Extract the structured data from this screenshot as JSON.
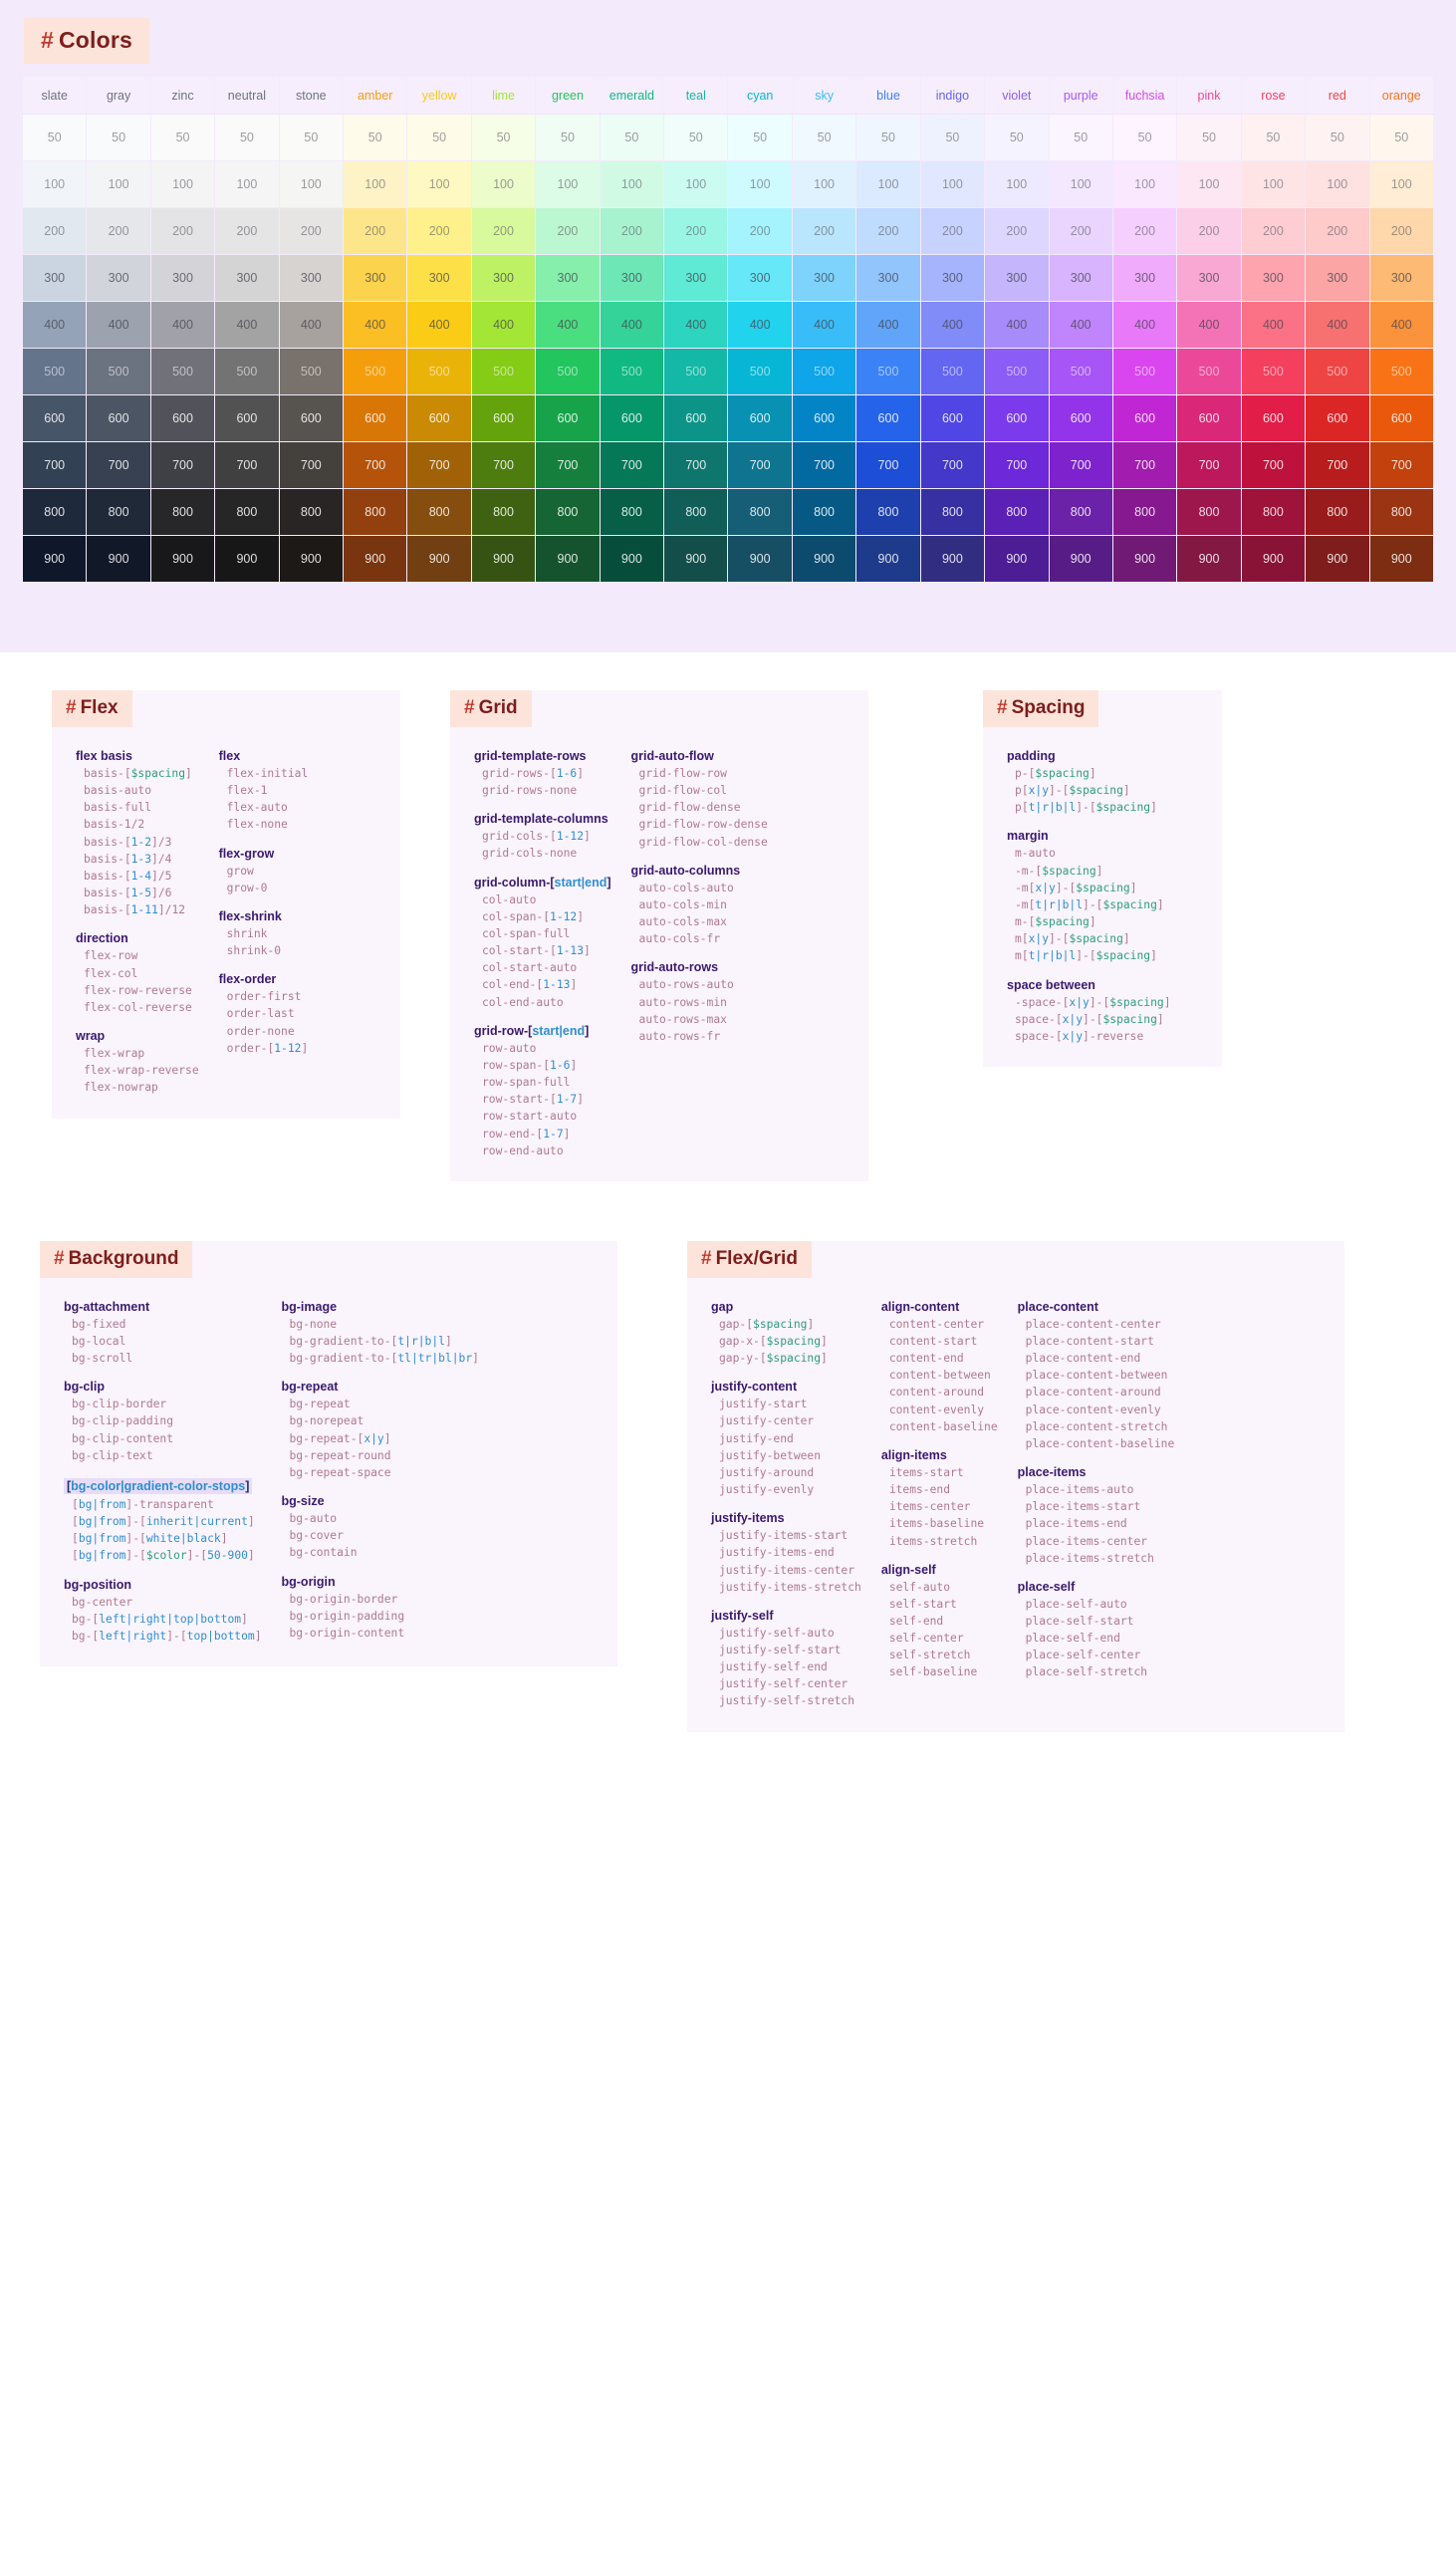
{
  "colors": {
    "heading": "Colors",
    "hash": "#",
    "columns": [
      "slate",
      "gray",
      "zinc",
      "neutral",
      "stone",
      "amber",
      "yellow",
      "lime",
      "green",
      "emerald",
      "teal",
      "cyan",
      "sky",
      "blue",
      "indigo",
      "violet",
      "purple",
      "fuchsia",
      "pink",
      "rose",
      "red",
      "orange"
    ],
    "header_text_colors": [
      "#6b7280",
      "#6b7280",
      "#6b7280",
      "#6b7280",
      "#6b7280",
      "#f59e0b",
      "#facc15",
      "#a3e635",
      "#22c55e",
      "#10b981",
      "#14b8a6",
      "#06b6d4",
      "#38bdf8",
      "#3b82f6",
      "#6366f1",
      "#8b5cf6",
      "#a855f7",
      "#d946ef",
      "#ec4899",
      "#f43f5e",
      "#ef4444",
      "#f97316"
    ],
    "shades": [
      "50",
      "100",
      "200",
      "300",
      "400",
      "500",
      "600",
      "700",
      "800",
      "900"
    ],
    "palette": {
      "slate": [
        "#f8fafc",
        "#f1f5f9",
        "#e2e8f0",
        "#cbd5e1",
        "#94a3b8",
        "#64748b",
        "#475569",
        "#334155",
        "#1e293b",
        "#0f172a"
      ],
      "gray": [
        "#f9fafb",
        "#f3f4f6",
        "#e5e7eb",
        "#d1d5db",
        "#9ca3af",
        "#6b7280",
        "#4b5563",
        "#374151",
        "#1f2937",
        "#111827"
      ],
      "zinc": [
        "#fafafa",
        "#f4f4f5",
        "#e4e4e7",
        "#d4d4d8",
        "#a1a1aa",
        "#71717a",
        "#52525b",
        "#3f3f46",
        "#27272a",
        "#18181b"
      ],
      "neutral": [
        "#fafafa",
        "#f5f5f5",
        "#e5e5e5",
        "#d4d4d4",
        "#a3a3a3",
        "#737373",
        "#525252",
        "#404040",
        "#262626",
        "#171717"
      ],
      "stone": [
        "#fafaf9",
        "#f5f5f4",
        "#e7e5e4",
        "#d6d3d1",
        "#a8a29e",
        "#78716c",
        "#57534e",
        "#44403c",
        "#292524",
        "#1c1917"
      ],
      "amber": [
        "#fffbeb",
        "#fef3c7",
        "#fde68a",
        "#fcd34d",
        "#fbbf24",
        "#f59e0b",
        "#d97706",
        "#b45309",
        "#92400e",
        "#78350f"
      ],
      "yellow": [
        "#fefce8",
        "#fef9c3",
        "#fef08a",
        "#fde047",
        "#facc15",
        "#eab308",
        "#ca8a04",
        "#a16207",
        "#854d0e",
        "#713f12"
      ],
      "lime": [
        "#f7fee7",
        "#ecfccb",
        "#d9f99d",
        "#bef264",
        "#a3e635",
        "#84cc16",
        "#65a30d",
        "#4d7c0f",
        "#3f6212",
        "#365314"
      ],
      "green": [
        "#f0fdf4",
        "#dcfce7",
        "#bbf7d0",
        "#86efac",
        "#4ade80",
        "#22c55e",
        "#16a34a",
        "#15803d",
        "#166534",
        "#14532d"
      ],
      "emerald": [
        "#ecfdf5",
        "#d1fae5",
        "#a7f3d0",
        "#6ee7b7",
        "#34d399",
        "#10b981",
        "#059669",
        "#047857",
        "#065f46",
        "#064e3b"
      ],
      "teal": [
        "#f0fdfa",
        "#ccfbf1",
        "#99f6e4",
        "#5eead4",
        "#2dd4bf",
        "#14b8a6",
        "#0d9488",
        "#0f766e",
        "#115e59",
        "#134e4a"
      ],
      "cyan": [
        "#ecfeff",
        "#cffafe",
        "#a5f3fc",
        "#67e8f9",
        "#22d3ee",
        "#06b6d4",
        "#0891b2",
        "#0e7490",
        "#155e75",
        "#164e63"
      ],
      "sky": [
        "#f0f9ff",
        "#e0f2fe",
        "#bae6fd",
        "#7dd3fc",
        "#38bdf8",
        "#0ea5e9",
        "#0284c7",
        "#0369a1",
        "#075985",
        "#0c4a6e"
      ],
      "blue": [
        "#eff6ff",
        "#dbeafe",
        "#bfdbfe",
        "#93c5fd",
        "#60a5fa",
        "#3b82f6",
        "#2563eb",
        "#1d4ed8",
        "#1e40af",
        "#1e3a8a"
      ],
      "indigo": [
        "#eef2ff",
        "#e0e7ff",
        "#c7d2fe",
        "#a5b4fc",
        "#818cf8",
        "#6366f1",
        "#4f46e5",
        "#4338ca",
        "#3730a3",
        "#312e81"
      ],
      "violet": [
        "#f5f3ff",
        "#ede9fe",
        "#ddd6fe",
        "#c4b5fd",
        "#a78bfa",
        "#8b5cf6",
        "#7c3aed",
        "#6d28d9",
        "#5b21b6",
        "#4c1d95"
      ],
      "purple": [
        "#faf5ff",
        "#f3e8ff",
        "#e9d5ff",
        "#d8b4fe",
        "#c084fc",
        "#a855f7",
        "#9333ea",
        "#7e22ce",
        "#6b21a8",
        "#581c87"
      ],
      "fuchsia": [
        "#fdf4ff",
        "#fae8ff",
        "#f5d0fe",
        "#f0abfc",
        "#e879f9",
        "#d946ef",
        "#c026d3",
        "#a21caf",
        "#86198f",
        "#701a75"
      ],
      "pink": [
        "#fdf2f8",
        "#fce7f3",
        "#fbcfe8",
        "#f9a8d4",
        "#f472b6",
        "#ec4899",
        "#db2777",
        "#be185d",
        "#9d174d",
        "#831843"
      ],
      "rose": [
        "#fff1f2",
        "#ffe4e6",
        "#fecdd3",
        "#fda4af",
        "#fb7185",
        "#f43f5e",
        "#e11d48",
        "#be123c",
        "#9f1239",
        "#881337"
      ],
      "red": [
        "#fef2f2",
        "#fee2e2",
        "#fecaca",
        "#fca5a5",
        "#f87171",
        "#ef4444",
        "#dc2626",
        "#b91c1c",
        "#991b1b",
        "#7f1d1d"
      ],
      "orange": [
        "#fff7ed",
        "#ffedd5",
        "#fed7aa",
        "#fdba74",
        "#fb923c",
        "#f97316",
        "#ea580c",
        "#c2410c",
        "#9a3412",
        "#7c2d12"
      ]
    }
  },
  "cards": [
    {
      "id": "flex",
      "heading": "Flex",
      "columns": [
        {
          "groups": [
            {
              "title": "flex basis",
              "highlight": false,
              "items": [
                "basis-[$spacing]",
                "basis-auto",
                "basis-full",
                "basis-1/2",
                "basis-[1-2]/3",
                "basis-[1-3]/4",
                "basis-[1-4]/5",
                "basis-[1-5]/6",
                "basis-[1-11]/12"
              ]
            },
            {
              "title": "direction",
              "highlight": false,
              "items": [
                "flex-row",
                "flex-col",
                "flex-row-reverse",
                "flex-col-reverse"
              ]
            },
            {
              "title": "wrap",
              "highlight": false,
              "items": [
                "flex-wrap",
                "flex-wrap-reverse",
                "flex-nowrap"
              ]
            }
          ]
        },
        {
          "groups": [
            {
              "title": "flex",
              "highlight": false,
              "items": [
                "flex-initial",
                "flex-1",
                "flex-auto",
                "flex-none"
              ]
            },
            {
              "title": "flex-grow",
              "highlight": false,
              "items": [
                "grow",
                "grow-0"
              ]
            },
            {
              "title": "flex-shrink",
              "highlight": false,
              "items": [
                "shrink",
                "shrink-0"
              ]
            },
            {
              "title": "flex-order",
              "highlight": false,
              "items": [
                "order-first",
                "order-last",
                "order-none",
                "order-[1-12]"
              ]
            }
          ]
        }
      ]
    },
    {
      "id": "grid",
      "heading": "Grid",
      "columns": [
        {
          "groups": [
            {
              "title": "grid-template-rows",
              "highlight": false,
              "items": [
                "grid-rows-[1-6]",
                "grid-rows-none"
              ]
            },
            {
              "title": "grid-template-columns",
              "highlight": false,
              "items": [
                "grid-cols-[1-12]",
                "grid-cols-none"
              ]
            },
            {
              "title": "grid-column-[start|end]",
              "highlight": false,
              "title_tokens": [
                "grid-column-[",
                "start|end",
                "]"
              ],
              "items": [
                "col-auto",
                "col-span-[1-12]",
                "col-span-full",
                "col-start-[1-13]",
                "col-start-auto",
                "col-end-[1-13]",
                "col-end-auto"
              ]
            },
            {
              "title": "grid-row-[start|end]",
              "highlight": false,
              "title_tokens": [
                "grid-row-[",
                "start|end",
                "]"
              ],
              "items": [
                "row-auto",
                "row-span-[1-6]",
                "row-span-full",
                "row-start-[1-7]",
                "row-start-auto",
                "row-end-[1-7]",
                "row-end-auto"
              ]
            }
          ]
        },
        {
          "groups": [
            {
              "title": "grid-auto-flow",
              "highlight": false,
              "items": [
                "grid-flow-row",
                "grid-flow-col",
                "grid-flow-dense",
                "grid-flow-row-dense",
                "grid-flow-col-dense"
              ]
            },
            {
              "title": "grid-auto-columns",
              "highlight": false,
              "items": [
                "auto-cols-auto",
                "auto-cols-min",
                "auto-cols-max",
                "auto-cols-fr"
              ]
            },
            {
              "title": "grid-auto-rows",
              "highlight": false,
              "items": [
                "auto-rows-auto",
                "auto-rows-min",
                "auto-rows-max",
                "auto-rows-fr"
              ]
            }
          ]
        }
      ]
    },
    {
      "id": "spacing",
      "heading": "Spacing",
      "columns": [
        {
          "groups": [
            {
              "title": "padding",
              "highlight": false,
              "items": [
                "p-[$spacing]",
                "p[x|y]-[$spacing]",
                "p[t|r|b|l]-[$spacing]"
              ]
            },
            {
              "title": "margin",
              "highlight": false,
              "items": [
                "m-auto",
                "-m-[$spacing]",
                "-m[x|y]-[$spacing]",
                "-m[t|r|b|l]-[$spacing]",
                "m-[$spacing]",
                "m[x|y]-[$spacing]",
                "m[t|r|b|l]-[$spacing]"
              ]
            },
            {
              "title": "space between",
              "highlight": false,
              "items": [
                "-space-[x|y]-[$spacing]",
                "space-[x|y]-[$spacing]",
                "space-[x|y]-reverse"
              ]
            }
          ]
        }
      ]
    },
    {
      "id": "background",
      "heading": "Background",
      "columns": [
        {
          "groups": [
            {
              "title": "bg-attachment",
              "highlight": false,
              "items": [
                "bg-fixed",
                "bg-local",
                "bg-scroll"
              ]
            },
            {
              "title": "bg-clip",
              "highlight": false,
              "items": [
                "bg-clip-border",
                "bg-clip-padding",
                "bg-clip-content",
                "bg-clip-text"
              ]
            },
            {
              "title": "[bg-color|gradient-color-stops]",
              "highlight": true,
              "items": [
                "[bg|from]-transparent",
                "[bg|from]-[inherit|current]",
                "[bg|from]-[white|black]",
                "[bg|from]-[$color]-[50-900]"
              ]
            },
            {
              "title": "bg-position",
              "highlight": false,
              "items": [
                "bg-center",
                "bg-[left|right|top|bottom]",
                "bg-[left|right]-[top|bottom]"
              ]
            }
          ]
        },
        {
          "groups": [
            {
              "title": "bg-image",
              "highlight": false,
              "items": [
                "bg-none",
                "bg-gradient-to-[t|r|b|l]",
                "bg-gradient-to-[tl|tr|bl|br]"
              ]
            },
            {
              "title": "bg-repeat",
              "highlight": false,
              "items": [
                "bg-repeat",
                "bg-norepeat",
                "bg-repeat-[x|y]",
                "bg-repeat-round",
                "bg-repeat-space"
              ]
            },
            {
              "title": "bg-size",
              "highlight": false,
              "items": [
                "bg-auto",
                "bg-cover",
                "bg-contain"
              ]
            },
            {
              "title": "bg-origin",
              "highlight": false,
              "items": [
                "bg-origin-border",
                "bg-origin-padding",
                "bg-origin-content"
              ]
            }
          ]
        }
      ]
    },
    {
      "id": "flexgrid",
      "heading": "Flex/Grid",
      "columns": [
        {
          "groups": [
            {
              "title": "gap",
              "highlight": false,
              "items": [
                "gap-[$spacing]",
                "gap-x-[$spacing]",
                "gap-y-[$spacing]"
              ]
            },
            {
              "title": "justify-content",
              "highlight": false,
              "items": [
                "justify-start",
                "justify-center",
                "justify-end",
                "justify-between",
                "justify-around",
                "justify-evenly"
              ]
            },
            {
              "title": "justify-items",
              "highlight": false,
              "items": [
                "justify-items-start",
                "justify-items-end",
                "justify-items-center",
                "justify-items-stretch"
              ]
            },
            {
              "title": "justify-self",
              "highlight": false,
              "items": [
                "justify-self-auto",
                "justify-self-start",
                "justify-self-end",
                "justify-self-center",
                "justify-self-stretch"
              ]
            }
          ]
        },
        {
          "groups": [
            {
              "title": "align-content",
              "highlight": false,
              "items": [
                "content-center",
                "content-start",
                "content-end",
                "content-between",
                "content-around",
                "content-evenly",
                "content-baseline"
              ]
            },
            {
              "title": "align-items",
              "highlight": false,
              "items": [
                "items-start",
                "items-end",
                "items-center",
                "items-baseline",
                "items-stretch"
              ]
            },
            {
              "title": "align-self",
              "highlight": false,
              "items": [
                "self-auto",
                "self-start",
                "self-end",
                "self-center",
                "self-stretch",
                "self-baseline"
              ]
            }
          ]
        },
        {
          "groups": [
            {
              "title": "place-content",
              "highlight": false,
              "items": [
                "place-content-center",
                "place-content-start",
                "place-content-end",
                "place-content-between",
                "place-content-around",
                "place-content-evenly",
                "place-content-stretch",
                "place-content-baseline"
              ]
            },
            {
              "title": "place-items",
              "highlight": false,
              "items": [
                "place-items-auto",
                "place-items-start",
                "place-items-end",
                "place-items-center",
                "place-items-stretch"
              ]
            },
            {
              "title": "place-self",
              "highlight": false,
              "items": [
                "place-self-auto",
                "place-self-start",
                "place-self-end",
                "place-self-center",
                "place-self-stretch"
              ]
            }
          ]
        }
      ]
    }
  ]
}
